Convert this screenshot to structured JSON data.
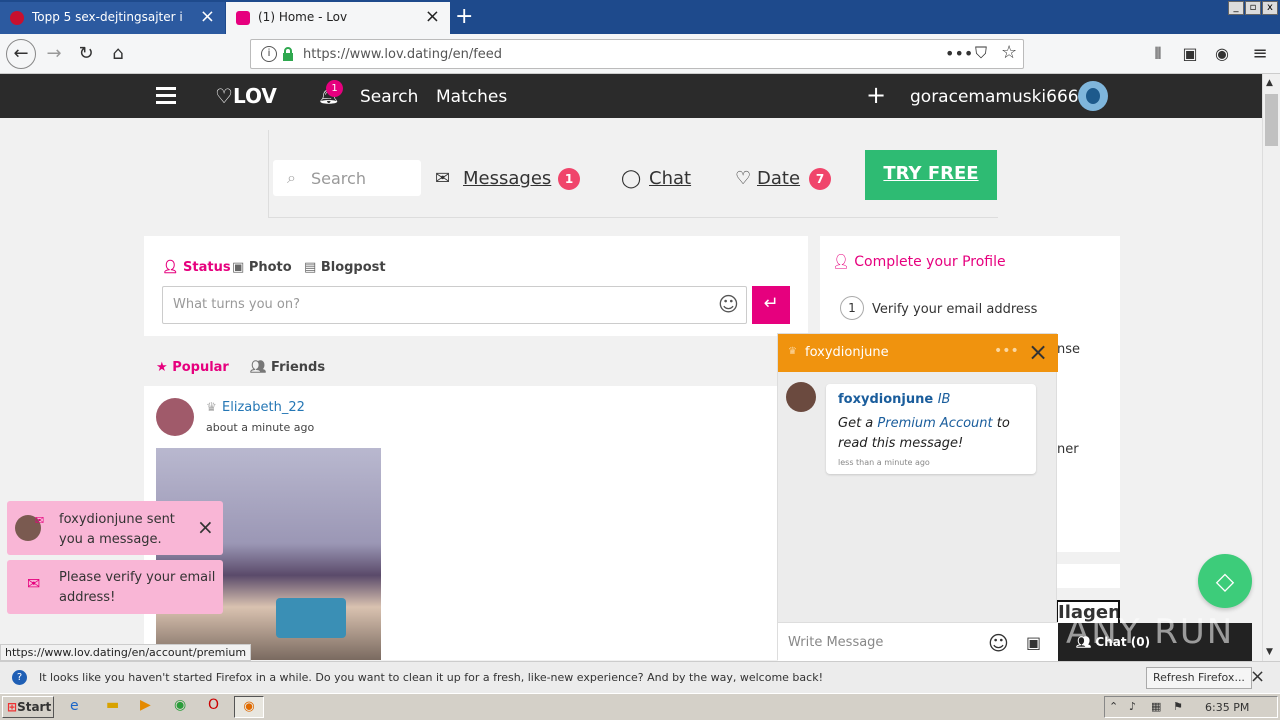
{
  "browser": {
    "tabs": [
      {
        "title": "Topp 5 sex-dejtingsajter i Sverige"
      },
      {
        "title": "(1) Home - Lov"
      }
    ],
    "url": "https://www.lov.dating/en/feed",
    "status_url": "https://www.lov.dating/en/account/premium",
    "notification": "It looks like you haven't started Firefox in a while. Do you want to clean it up for a fresh, like-new experience? And by the way, welcome back!",
    "notification_button": "Refresh Firefox..."
  },
  "site": {
    "logo": "LOV",
    "notif_count": "1",
    "nav": {
      "search": "Search",
      "matches": "Matches"
    },
    "username": "goracemamuski666"
  },
  "subnav": {
    "search_placeholder": "Search",
    "messages": "Messages",
    "messages_count": "1",
    "chat": "Chat",
    "date": "Date",
    "date_count": "7",
    "try_free": "TRY FREE"
  },
  "composer": {
    "tabs": {
      "status": "Status",
      "photo": "Photo",
      "blogpost": "Blogpost"
    },
    "placeholder": "What turns you on?"
  },
  "feed": {
    "tabs": {
      "popular": "Popular",
      "friends": "Friends"
    },
    "post": {
      "author": "Elizabeth_22",
      "time": "about a minute ago"
    }
  },
  "profile": {
    "title": "Complete your Profile",
    "step1_num": "1",
    "step1": "Verify your email address",
    "partial1": "nse",
    "partial2": "ner"
  },
  "chat": {
    "header_name": "foxydionjune",
    "sender": "foxydionjune",
    "sender_badge": "IB",
    "msg_prefix": "Get a",
    "msg_link": "Premium Account",
    "msg_suffix": "to read this message!",
    "time": "less than a minute ago",
    "input_placeholder": "Write Message",
    "dock_label": "Chat (0)"
  },
  "toasts": [
    {
      "text": "foxydionjune sent you a message."
    },
    {
      "text": "Please verify your email address!"
    }
  ],
  "partial_banner": "Ilagen",
  "watermark": "ANY RUN",
  "taskbar": {
    "start": "Start",
    "time": "6:35 PM"
  },
  "colors": {
    "accent": "#e6007e",
    "green": "#2ebb73",
    "orange": "#f0930e",
    "header": "#2b2b2b"
  }
}
